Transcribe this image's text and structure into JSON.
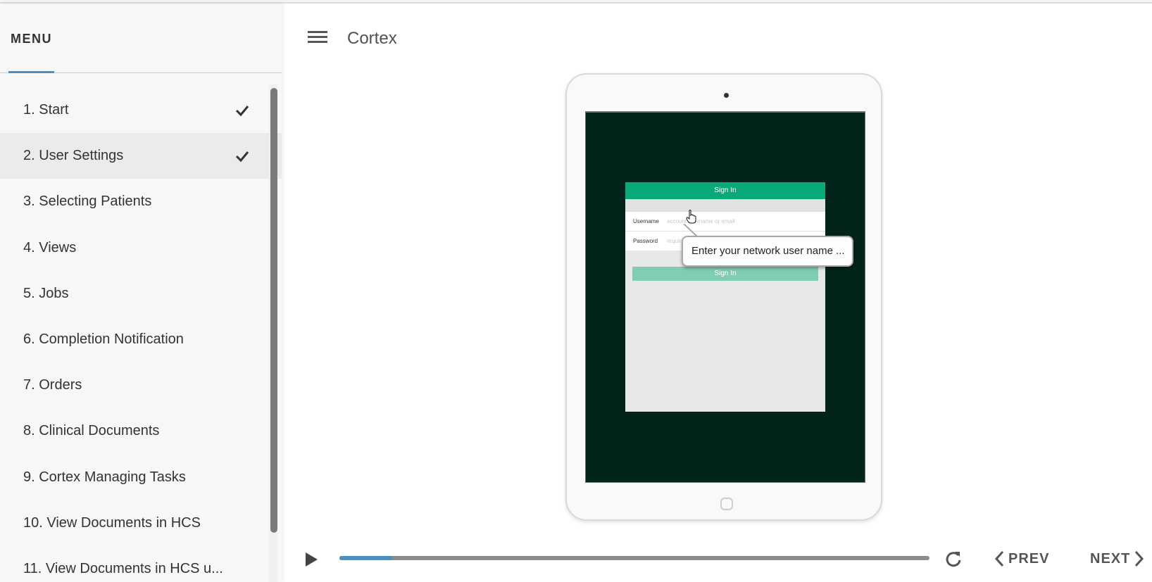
{
  "sidebar": {
    "title": "MENU",
    "items": [
      {
        "label": "1. Start",
        "completed": true
      },
      {
        "label": "2. User Settings",
        "completed": true
      },
      {
        "label": "3. Selecting Patients",
        "completed": false
      },
      {
        "label": "4. Views",
        "completed": false
      },
      {
        "label": "5. Jobs",
        "completed": false
      },
      {
        "label": "6. Completion Notification",
        "completed": false
      },
      {
        "label": "7. Orders",
        "completed": false
      },
      {
        "label": "8. Clinical Documents",
        "completed": false
      },
      {
        "label": "9. Cortex Managing Tasks",
        "completed": false
      },
      {
        "label": "10. View Documents in HCS",
        "completed": false
      },
      {
        "label": "11. View Documents in HCS u...",
        "completed": false
      }
    ],
    "active_index": 1
  },
  "header": {
    "menu_icon": "hamburger-icon",
    "title": "Cortex"
  },
  "slide": {
    "signin": {
      "header": "Sign In",
      "username_label": "Username",
      "username_placeholder": "account username or email",
      "password_label": "Password",
      "password_placeholder": "required",
      "button_label": "Sign In"
    },
    "callout_text": "Enter your network user name ...",
    "colors": {
      "screen_bg": "#03241b",
      "signin_header": "#0aa97a",
      "signin_button": "#7fcdb2"
    }
  },
  "controls": {
    "play_icon": "play-icon",
    "progress_fraction": 0.09,
    "replay_icon": "replay-icon",
    "prev_label": "PREV",
    "next_label": "NEXT",
    "accent": "#4a90c2"
  }
}
